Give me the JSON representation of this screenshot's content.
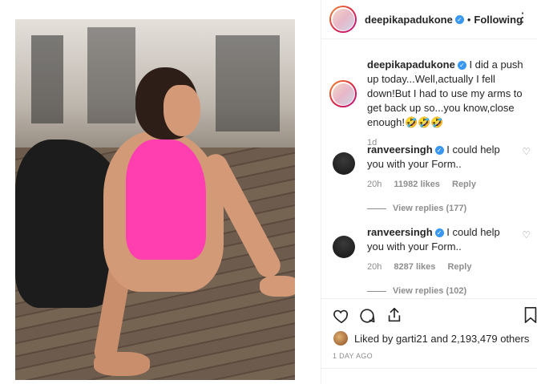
{
  "post": {
    "username": "deepikapadukone",
    "follow_sep": "•",
    "follow_label": "Following",
    "more_icon": "more-dots-icon"
  },
  "caption": {
    "username": "deepikapadukone",
    "text": "I did a push up today...Well,actually I fell down!But I had to use my arms to get back up so...you know,close enough!🤣🤣🤣",
    "time": "1d"
  },
  "comments": [
    {
      "username": "ranveersingh",
      "text": "I could help you with your Form..",
      "time": "20h",
      "likes": "11982 likes",
      "reply": "Reply",
      "view_replies": "View replies (177)"
    },
    {
      "username": "ranveersingh",
      "text": "I could help you with your Form..",
      "time": "20h",
      "likes": "8287 likes",
      "reply": "Reply",
      "view_replies": "View replies (102)"
    }
  ],
  "actions": {
    "liked_by_prefix": "Liked by",
    "liked_by_user": "garti21",
    "liked_by_suffix": "and",
    "likes_count": "2,193,479 others",
    "time_ago": "1 DAY AGO"
  },
  "colors": {
    "accent": "#3897f0",
    "pink": "#ff3fb0",
    "meta_gray": "#8e8e8e"
  }
}
